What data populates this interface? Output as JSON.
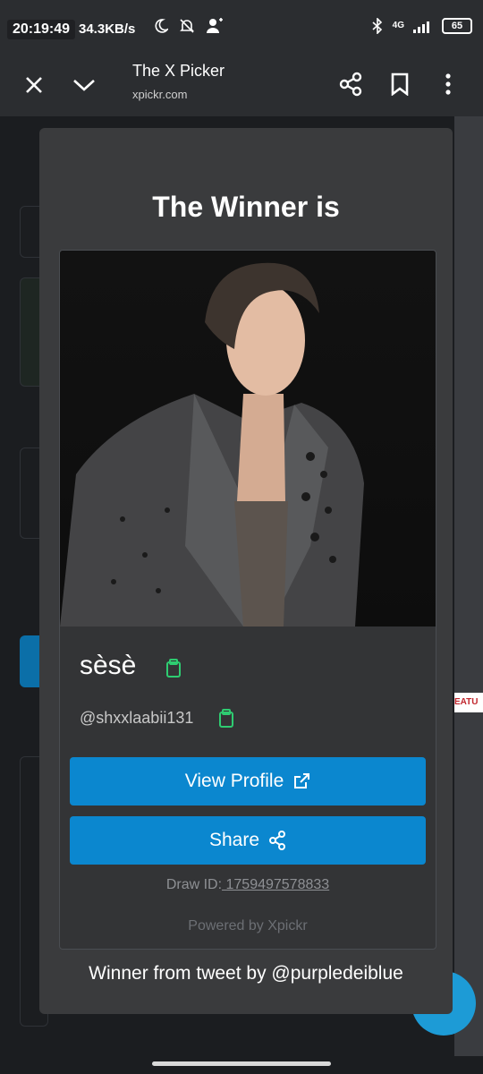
{
  "status": {
    "time": "20:19:49",
    "speed": "34.3KB/s",
    "network": "4G",
    "battery": "65"
  },
  "browser": {
    "title": "The X Picker",
    "url": "xpickr.com"
  },
  "background": {
    "feature_label": "EATU"
  },
  "modal": {
    "title": "The Winner is",
    "winner_name": "sèsè",
    "winner_handle": "@shxxlaabii131",
    "view_profile_label": "View Profile",
    "share_label": "Share",
    "draw_id_label": "Draw ID:",
    "draw_id_value": " 1759497578833",
    "powered_by": "Powered by Xpickr",
    "footer": "Winner from tweet by @purpledeiblue"
  },
  "colors": {
    "accent": "#0b87cf",
    "copy_icon": "#2ecc71",
    "modal_bg": "#3a3b3d"
  }
}
